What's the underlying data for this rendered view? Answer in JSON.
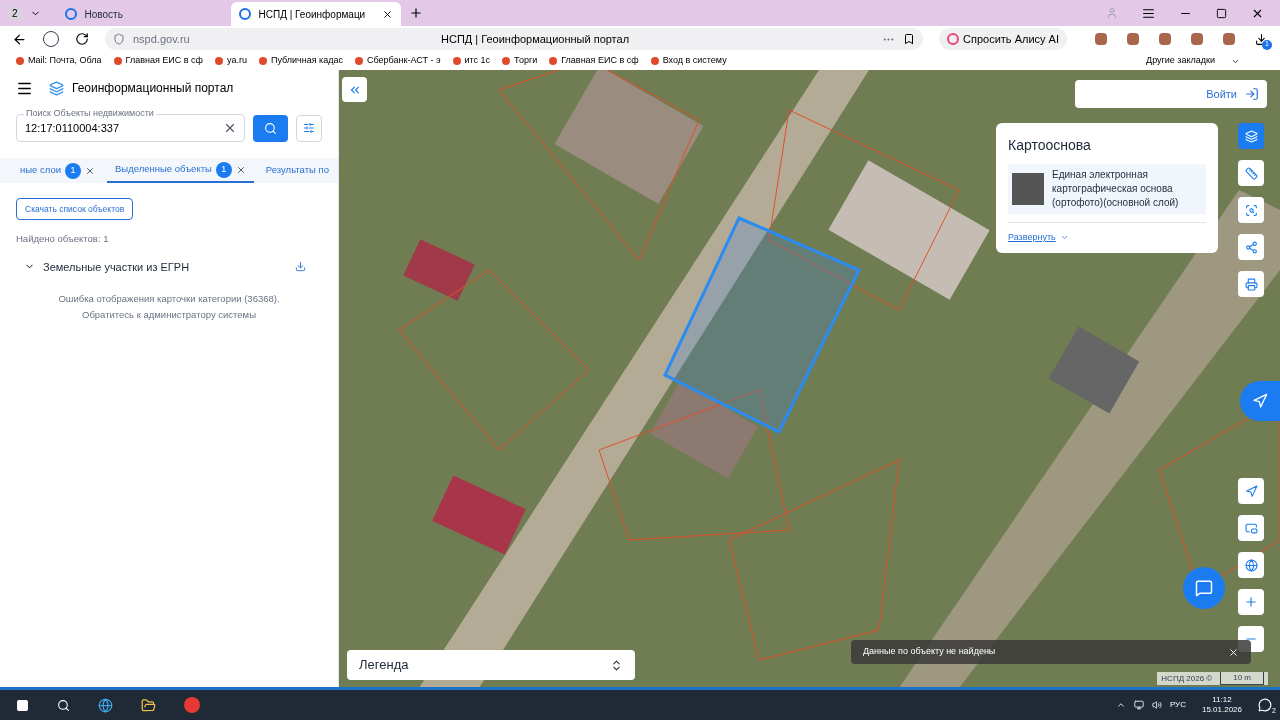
{
  "browser": {
    "tab_count": "2",
    "tabs": [
      {
        "title": "Новость",
        "selected": false
      },
      {
        "title": "НСПД | Геоинформаци",
        "selected": true
      }
    ],
    "url": "nspd.gov.ru",
    "page_title": "НСПД | Геоинформационный портал",
    "alice": "Спросить Алису AI",
    "downloads_badge": "1",
    "bookmarks": [
      "Mail: Почта, Обла",
      "Главная ЕИС в сф",
      "ya.ru",
      "Публичная кадас",
      "Сбербанк-АСТ - э",
      "итс 1с",
      "Торги",
      "Главная ЕИС в сф",
      "Вход в систему"
    ],
    "other_bookmarks": "Другие закладки"
  },
  "sidebar": {
    "title": "Геоинформационный портал",
    "search": {
      "placeholder": "Поиск Объекты недвижимости",
      "value": "12:17:0110004:337"
    },
    "tabs": [
      {
        "label": "ные слои",
        "count": "1",
        "selected": false
      },
      {
        "label": "Выделенные объекты",
        "count": "1",
        "selected": true
      },
      {
        "label": "Результаты по",
        "selected": false
      }
    ],
    "download_button": "Скачать список объектов",
    "found": "Найдено объектов: 1",
    "group": {
      "title": "Земельные участки из ЕГРН",
      "expanded": true
    },
    "error": "Ошибка отображения карточки категории (36368). Обратитесь к администратору системы"
  },
  "map": {
    "login": "Войти",
    "basemap": {
      "title": "Картооснова",
      "layer": "Единая электронная картографическая основа (ортофото)(основной слой)",
      "expand": "Развернуть"
    },
    "legend": "Легенда",
    "toast": "Данные по объекту не найдены",
    "attribution": "НСПД 2026 ©",
    "scale": "10 m"
  },
  "taskbar": {
    "lang": "РУС",
    "time": "11:12",
    "date": "15.01.2026",
    "notifications": "2"
  }
}
